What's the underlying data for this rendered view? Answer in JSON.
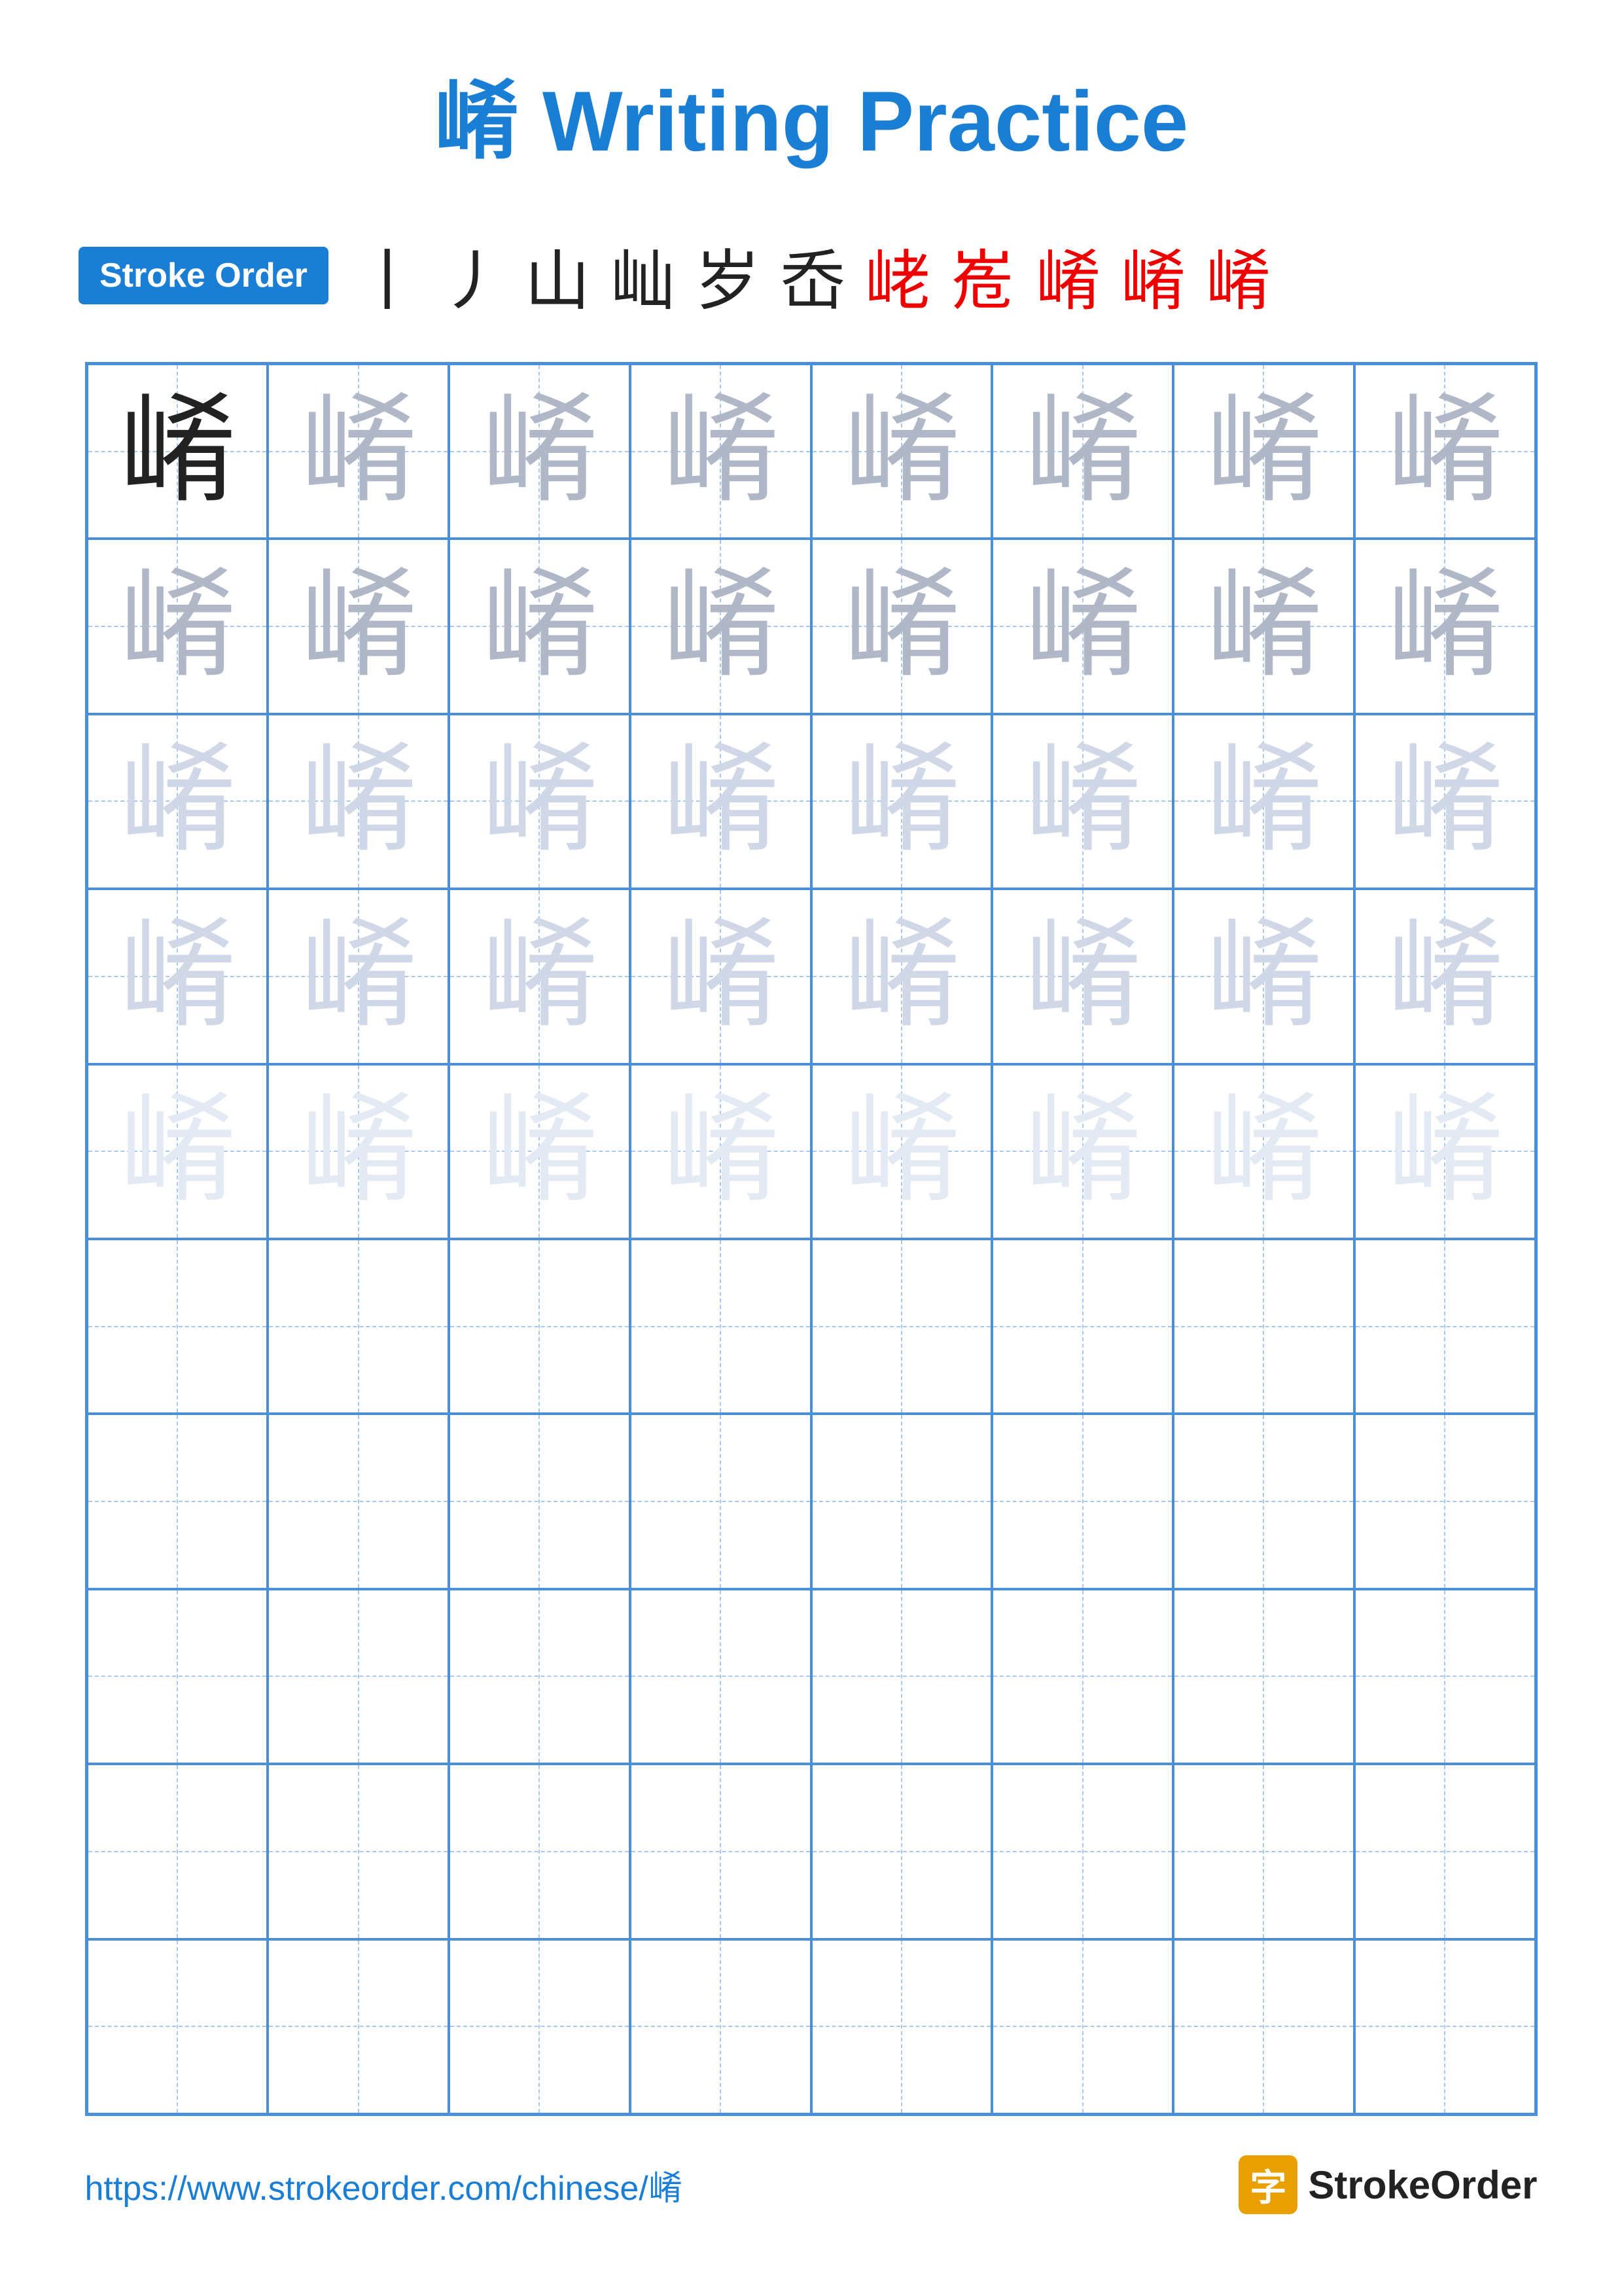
{
  "title": {
    "char": "崤",
    "text": " Writing Practice"
  },
  "stroke_order": {
    "badge_label": "Stroke Order",
    "strokes": [
      "丨",
      "丿",
      "山",
      "山丿",
      "山✕",
      "岙",
      "峔",
      "峞",
      "峞奇",
      "崤奇",
      "崤"
    ]
  },
  "character": "崤",
  "grid": {
    "rows": 10,
    "cols": 8,
    "filled_rows": 5,
    "empty_rows": 5
  },
  "footer": {
    "url": "https://www.strokeorder.com/chinese/崤",
    "logo_char": "字",
    "logo_text": "StrokeOrder"
  }
}
